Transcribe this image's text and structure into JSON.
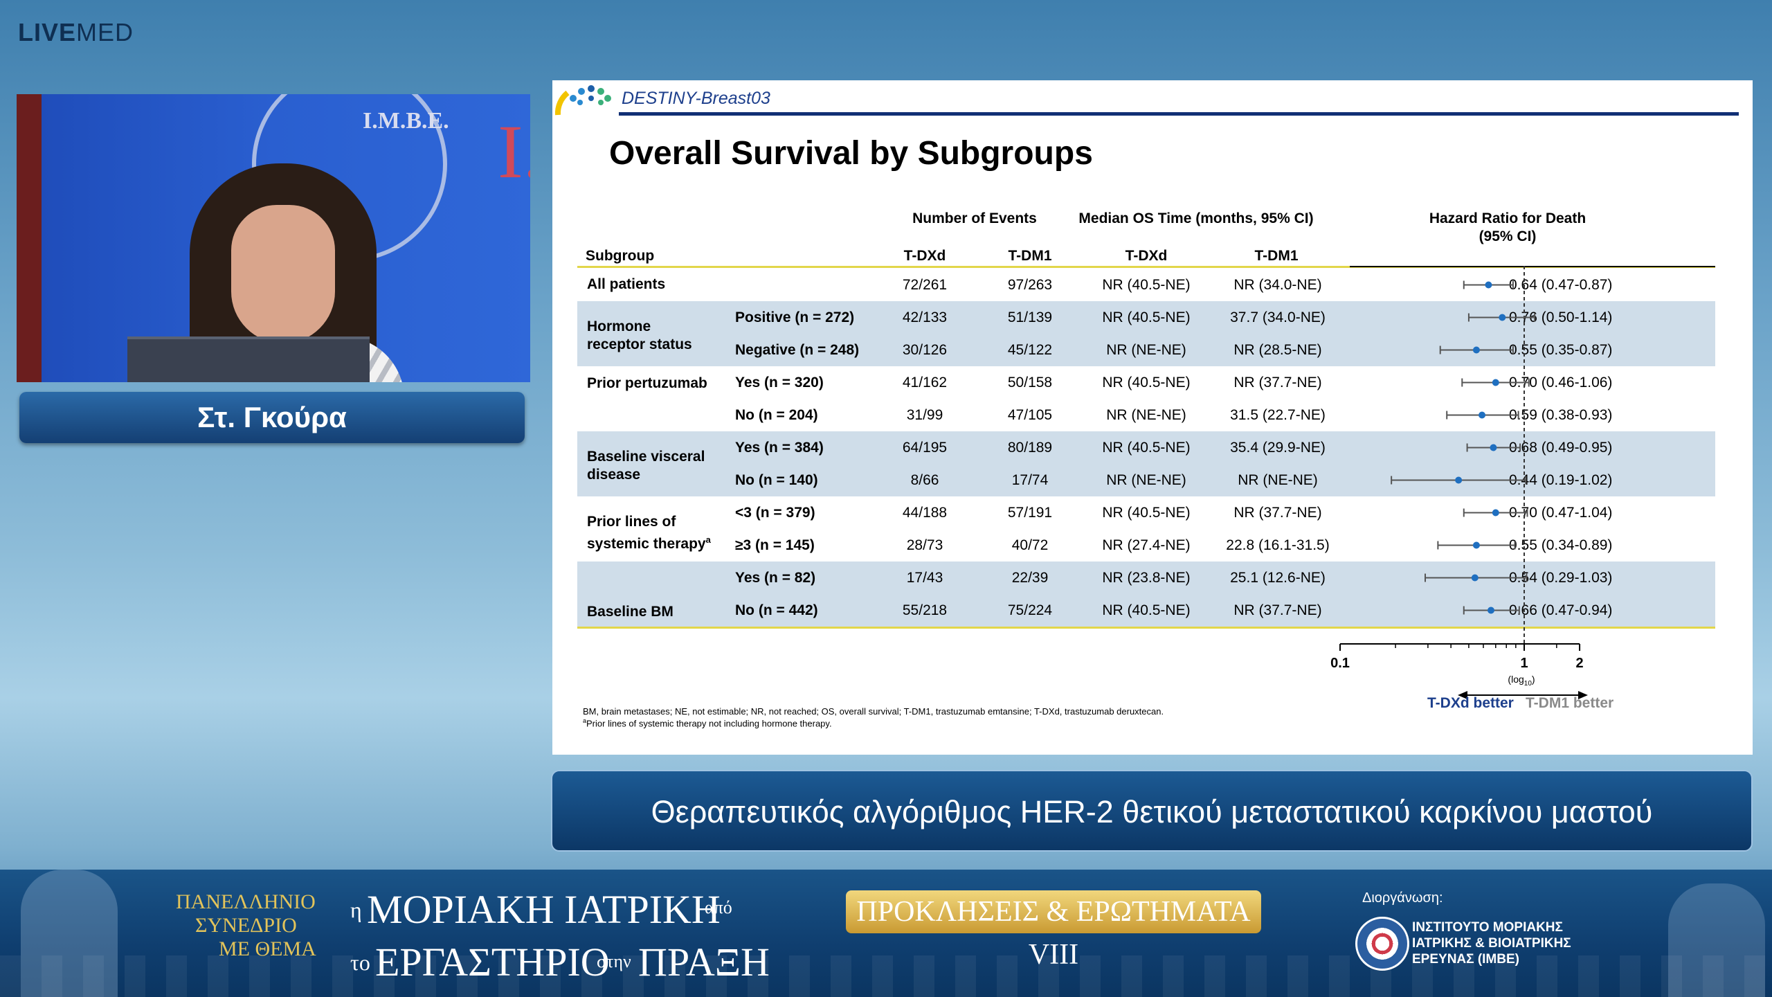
{
  "brand": {
    "bold": "LIVE",
    "rest": "MED"
  },
  "video": {
    "logo_text": "I.M.B.E."
  },
  "speaker": {
    "name": "Στ. Γκούρα"
  },
  "slide": {
    "trial": "DESTINY-Breast03",
    "title": "Overall Survival by Subgroups",
    "headers": {
      "number_of_events": "Number of Events",
      "median_os": "Median OS Time (months, 95% CI)",
      "hazard_ratio": "Hazard Ratio for Death",
      "hazard_ratio_ci": "(95% CI)",
      "subgroup": "Subgroup",
      "tdxd": "T-DXd",
      "tdm1": "T-DM1",
      "tdxd2": "T-DXd",
      "tdm12": "T-DM1"
    },
    "groups": [
      {
        "label": "All patients"
      },
      {
        "label": "Hormone receptor status"
      },
      {
        "label": "Prior pertuzumab"
      },
      {
        "label": "Baseline visceral disease"
      },
      {
        "label": "Prior lines of systemic therapy",
        "sup": "a"
      },
      {
        "label": "Baseline BM"
      }
    ],
    "rows": [
      {
        "sub": "",
        "ev_tdxd": "72/261",
        "ev_tdm1": "97/263",
        "os_tdxd": "NR (40.5-NE)",
        "os_tdm1": "NR (34.0-NE)",
        "hr": "0.64 (0.47-0.87)"
      },
      {
        "sub": "Positive (n = 272)",
        "ev_tdxd": "42/133",
        "ev_tdm1": "51/139",
        "os_tdxd": "NR (40.5-NE)",
        "os_tdm1": "37.7 (34.0-NE)",
        "hr": "0.76 (0.50-1.14)"
      },
      {
        "sub": "Negative (n = 248)",
        "ev_tdxd": "30/126",
        "ev_tdm1": "45/122",
        "os_tdxd": "NR (NE-NE)",
        "os_tdm1": "NR (28.5-NE)",
        "hr": "0.55 (0.35-0.87)"
      },
      {
        "sub": "Yes (n = 320)",
        "ev_tdxd": "41/162",
        "ev_tdm1": "50/158",
        "os_tdxd": "NR (40.5-NE)",
        "os_tdm1": "NR (37.7-NE)",
        "hr": "0.70 (0.46-1.06)"
      },
      {
        "sub": "No (n = 204)",
        "ev_tdxd": "31/99",
        "ev_tdm1": "47/105",
        "os_tdxd": "NR (NE-NE)",
        "os_tdm1": "31.5 (22.7-NE)",
        "hr": "0.59 (0.38-0.93)"
      },
      {
        "sub": "Yes (n = 384)",
        "ev_tdxd": "64/195",
        "ev_tdm1": "80/189",
        "os_tdxd": "NR (40.5-NE)",
        "os_tdm1": "35.4 (29.9-NE)",
        "hr": "0.68 (0.49-0.95)"
      },
      {
        "sub": "No (n = 140)",
        "ev_tdxd": "8/66",
        "ev_tdm1": "17/74",
        "os_tdxd": "NR (NE-NE)",
        "os_tdm1": "NR (NE-NE)",
        "hr": "0.44 (0.19-1.02)"
      },
      {
        "sub": "<3 (n = 379)",
        "ev_tdxd": "44/188",
        "ev_tdm1": "57/191",
        "os_tdxd": "NR (40.5-NE)",
        "os_tdm1": "NR (37.7-NE)",
        "hr": "0.70 (0.47-1.04)"
      },
      {
        "sub": "≥3 (n = 145)",
        "ev_tdxd": "28/73",
        "ev_tdm1": "40/72",
        "os_tdxd": "NR (27.4-NE)",
        "os_tdm1": "22.8 (16.1-31.5)",
        "hr": "0.55 (0.34-0.89)"
      },
      {
        "sub": "Yes (n = 82)",
        "ev_tdxd": "17/43",
        "ev_tdm1": "22/39",
        "os_tdxd": "NR (23.8-NE)",
        "os_tdm1": "25.1 (12.6-NE)",
        "hr": "0.54 (0.29-1.03)"
      },
      {
        "sub": "No (n = 442)",
        "ev_tdxd": "55/218",
        "ev_tdm1": "75/224",
        "os_tdxd": "NR (40.5-NE)",
        "os_tdm1": "NR (37.7-NE)",
        "hr": "0.66 (0.47-0.94)"
      }
    ],
    "forest": {
      "hr": [
        0.64,
        0.76,
        0.55,
        0.7,
        0.59,
        0.68,
        0.44,
        0.7,
        0.55,
        0.54,
        0.66
      ],
      "lo": [
        0.47,
        0.5,
        0.35,
        0.46,
        0.38,
        0.49,
        0.19,
        0.47,
        0.34,
        0.29,
        0.47
      ],
      "hi": [
        0.87,
        1.14,
        0.87,
        1.06,
        0.93,
        0.95,
        1.02,
        1.04,
        0.89,
        1.03,
        0.94
      ],
      "ticks": [
        "0.1",
        "1",
        "2"
      ],
      "scale_label": "(log",
      "scale_sub": "10",
      "scale_close": ")",
      "point_color": "#1f6fc0"
    },
    "footnote1": "BM, brain metastases; NE, not estimable; NR, not reached; OS, overall survival; T-DM1, trastuzumab emtansine; T-DXd, trastuzumab deruxtecan.",
    "footnote2_sup": "a",
    "footnote2": "Prior lines of systemic therapy not including hormone therapy.",
    "better_left": "T-DXd better",
    "better_right": "T-DM1 better"
  },
  "topic": "Θεραπευτικός αλγόριθμος HER-2 θετικού μεταστατικού καρκίνου μαστού",
  "banner": {
    "pan1": "ΠΑΝΕΛΛΗΝΙΟ",
    "pan2": "ΣΥΝΕΔΡΙΟ",
    "pan3": "ΜΕ ΘΕΜΑ",
    "line1_a": "η",
    "line1_b": "ΜΟΡΙΑΚΗ ΙΑΤΡΙΚΗ",
    "line1_c": "από",
    "line2_a": "το",
    "line2_b": "ΕΡΓΑΣΤΗΡΙΟ",
    "line2_c": "στην",
    "line2_d": "ΠΡΑΞΗ",
    "pill": "ΠΡΟΚΛΗΣΕΙΣ & ΕΡΩΤΗΜΑΤΑ VIII",
    "org_label": "Διοργάνωση:",
    "org1": "ΙΝΣΤΙΤΟΥΤΟ ΜΟΡΙΑΚΗΣ",
    "org2": "ΙΑΤΡΙΚΗΣ & ΒΙΟΙΑΤΡΙΚΗΣ",
    "org3": "ΕΡΕΥΝΑΣ (ΙΜΒΕ)"
  }
}
